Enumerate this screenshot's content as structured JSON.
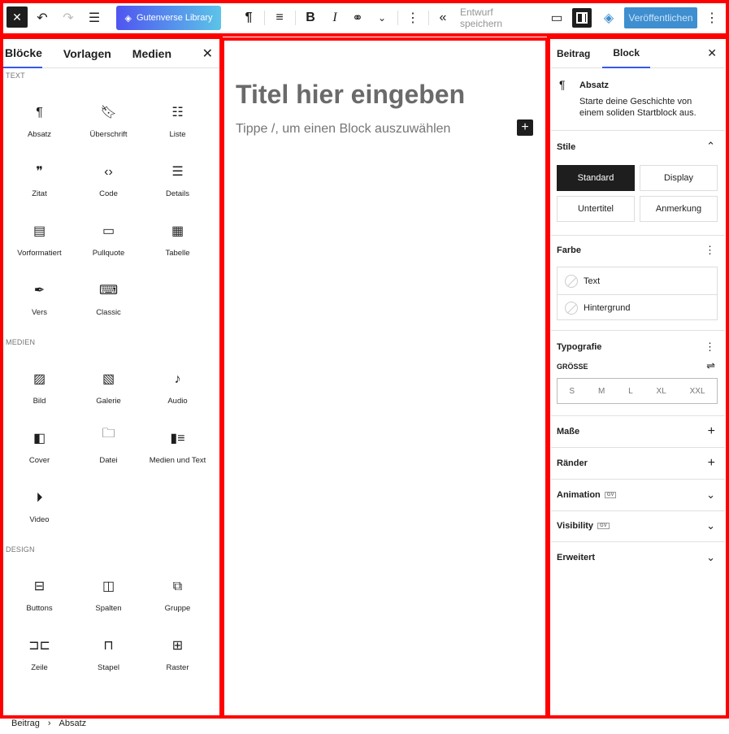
{
  "toolbar": {
    "library_label": "Gutenverse Library",
    "draft_label": "Entwurf speichern",
    "publish_label": "Veröffentlichen"
  },
  "inserter": {
    "tabs": [
      "Blöcke",
      "Vorlagen",
      "Medien"
    ],
    "categories": {
      "text": "TEXT",
      "media": "MEDIEN",
      "design": "DESIGN"
    },
    "text_blocks": [
      "Absatz",
      "Überschrift",
      "Liste",
      "Zitat",
      "Code",
      "Details",
      "Vorformatiert",
      "Pullquote",
      "Tabelle",
      "Vers",
      "Classic"
    ],
    "media_blocks": [
      "Bild",
      "Galerie",
      "Audio",
      "Cover",
      "Datei",
      "Medien und Text",
      "Video"
    ],
    "design_blocks": [
      "Buttons",
      "Spalten",
      "Gruppe",
      "Zeile",
      "Stapel",
      "Raster"
    ]
  },
  "canvas": {
    "title_placeholder": "Titel hier eingeben",
    "block_placeholder": "Tippe /, um einen Block auszuwählen"
  },
  "settings": {
    "tabs": [
      "Beitrag",
      "Block"
    ],
    "block_title": "Absatz",
    "block_desc": "Starte deine Geschichte von einem soliden Startblock aus.",
    "styles_title": "Stile",
    "styles": [
      "Standard",
      "Display",
      "Untertitel",
      "Anmerkung"
    ],
    "color_title": "Farbe",
    "colors": [
      "Text",
      "Hintergrund"
    ],
    "typo_title": "Typografie",
    "size_label": "GRÖSSE",
    "sizes": [
      "S",
      "M",
      "L",
      "XL",
      "XXL"
    ],
    "dimensions": "Maße",
    "borders": "Ränder",
    "animation": "Animation",
    "visibility": "Visibility",
    "advanced": "Erweitert",
    "badge": "GV"
  },
  "breadcrumb": [
    "Beitrag",
    "Absatz"
  ]
}
